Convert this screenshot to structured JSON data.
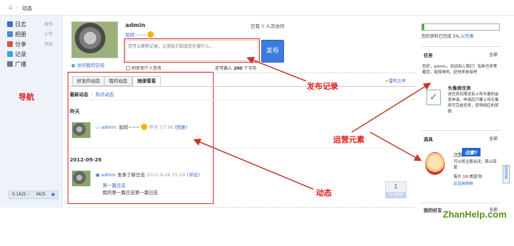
{
  "header": {
    "home_icon": "home-icon",
    "breadcrumb": "动态"
  },
  "sidebar": {
    "items": [
      {
        "label": "日志",
        "action": "发布",
        "icon": "blog-icon",
        "color": "#3b6bc9"
      },
      {
        "label": "相册",
        "action": "上传",
        "icon": "album-icon",
        "color": "#4a89d4"
      },
      {
        "label": "分享",
        "action": "添加",
        "icon": "share-icon",
        "color": "#e24b4b"
      },
      {
        "label": "记录",
        "action": "",
        "icon": "record-icon",
        "color": "#39a3d9"
      },
      {
        "label": "广播",
        "action": "",
        "icon": "broadcast-icon",
        "color": "#6b7a8c"
      }
    ],
    "status": {
      "up": "0.1K/S",
      "down": "0K/S"
    }
  },
  "profile": {
    "name": "admin",
    "status": "加班~~~",
    "visit_link": "访问我的空间",
    "visits_pre": "已有",
    "visits_count": "0",
    "visits_post": "人次访问"
  },
  "composer": {
    "placeholder": "您可以更新记录，让朋友们知道您在做什么...",
    "publish": "发布",
    "sync": "同步到个人签名",
    "remain_pre": "还可输入",
    "remain_count": "200",
    "remain_post": "个字符"
  },
  "feed_tabs": [
    "好友的动态",
    "我的动态",
    "随便看看"
  ],
  "feed_subtabs": [
    "最新动态",
    "热点动态"
  ],
  "wake_link": "雷鸣之声",
  "feed": {
    "group1": "昨天",
    "item1": {
      "user": "admin",
      "text": "加班~~~",
      "time": "昨天 17:36",
      "reply": "(回复)"
    },
    "group2": "2012-09-26",
    "item2": {
      "user": "admin",
      "action": "发表了新日志",
      "time": "2012-9-26 15:24",
      "comment": "(评论)",
      "title": "第一篇日志",
      "excerpt": "我的第一篇日志第一篇日志",
      "votes": "1",
      "vote_label": "马上参与"
    }
  },
  "right": {
    "progress_pct": 3,
    "progress_text": "您的资料已完成 3%,",
    "progress_link": "以完善",
    "task_title": "任务",
    "task_all": "全部",
    "task_intro": "您好，admin，欢迎加入我们！有新任务等着您，挺简单的，赶快来参加吧",
    "task_name": "头像类任务",
    "task_desc": "该任务仅限没有上传头像的会员申请，申请后只要上传头像即可完成任务，获得相应的奖励",
    "props_title": "道具",
    "props_all": "全部",
    "prop_name": "沉默卡",
    "prop_badge": "迅雷7",
    "prop_desc": "可以将主题关闭，禁止回复",
    "prop_price_pre": "售价",
    "prop_price": "10",
    "prop_price_post": "威望/张",
    "prop_link": "此道具购物",
    "friends_title": "我的好友",
    "friends_all": "全部",
    "watermark": "ZhanHelp.com",
    "side_tab": "返回顶部"
  },
  "annotations": {
    "nav": "导航",
    "publish": "发布记录",
    "ops": "运营元素",
    "feed": "动态"
  }
}
